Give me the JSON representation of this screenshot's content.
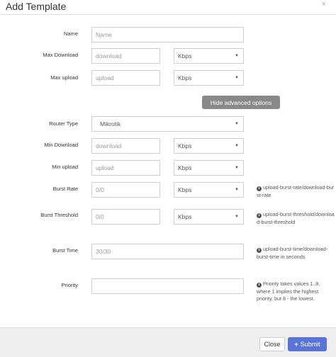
{
  "modal": {
    "title": "Add Template",
    "close_glyph": "×"
  },
  "form": {
    "name": {
      "label": "Name",
      "placeholder": "Name"
    },
    "max_download": {
      "label": "Max Download",
      "placeholder": "download",
      "unit": "Kbps"
    },
    "max_upload": {
      "label": "Max upload",
      "placeholder": "upload",
      "unit": "Kbps"
    },
    "advanced_toggle": "Hide advanced options",
    "router_type": {
      "label": "Router Type",
      "value": "Mikrotik"
    },
    "min_download": {
      "label": "Min Download",
      "placeholder": "download",
      "unit": "Kbps"
    },
    "min_upload": {
      "label": "Min upload",
      "placeholder": "upload",
      "unit": "Kbps"
    },
    "burst_rate": {
      "label": "Burst Rate",
      "placeholder": "0/0",
      "unit": "Kbps",
      "help": "upload-burst-rate/download-burst-rate"
    },
    "burst_threshold": {
      "label": "Burst Threshold",
      "placeholder": "0/0",
      "unit": "Kbps",
      "help": "upload-burst-threshold/download-burst-threshold"
    },
    "burst_time": {
      "label": "Burst Time",
      "placeholder": "30/30",
      "help": "upload-burst-time/download-burst-time in seconds"
    },
    "priority": {
      "label": "Priority",
      "placeholder": "",
      "help": "Priority takes values 1..8, where 1 implies the highest priority, but 8 - the lowest."
    }
  },
  "footer": {
    "close_label": "Close",
    "submit_label": "Submit",
    "submit_glyph": "+"
  },
  "icons": {
    "info": "info-circle-icon",
    "caret": "caret-down-icon",
    "plus": "plus-icon"
  }
}
